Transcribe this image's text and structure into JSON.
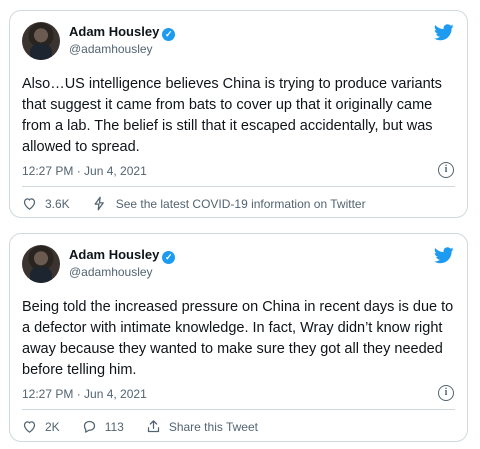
{
  "tweets": [
    {
      "author_name": "Adam Housley",
      "verified_mark": "✓",
      "handle": "@adamhousley",
      "text": "Also…US intelligence believes China is trying to produce variants that suggest it came from bats to cover up that it originally came from a lab. The belief is still that it escaped accidentally, but was allowed to spread.",
      "timestamp": "12:27 PM · Jun 4, 2021",
      "info_glyph": "i",
      "likes": "3.6K",
      "covid_link": "See the latest COVID-19 information on Twitter"
    },
    {
      "author_name": "Adam Housley",
      "verified_mark": "✓",
      "handle": "@adamhousley",
      "text": "Being told the increased pressure on China in recent days is due to a defector with intimate knowledge. In fact, Wray didn’t know right away because they wanted to make sure they got all they needed before telling him.",
      "timestamp": "12:27 PM · Jun 4, 2021",
      "info_glyph": "i",
      "likes": "2K",
      "replies": "113",
      "share_label": "Share this Tweet"
    }
  ],
  "colors": {
    "twitter_blue": "#1d9bf0",
    "muted_text": "#536471",
    "border": "#cfd9de"
  },
  "icons": [
    "twitter-bird-icon",
    "verified-icon",
    "info-icon",
    "heart-icon",
    "lightning-icon",
    "reply-icon",
    "share-icon"
  ]
}
